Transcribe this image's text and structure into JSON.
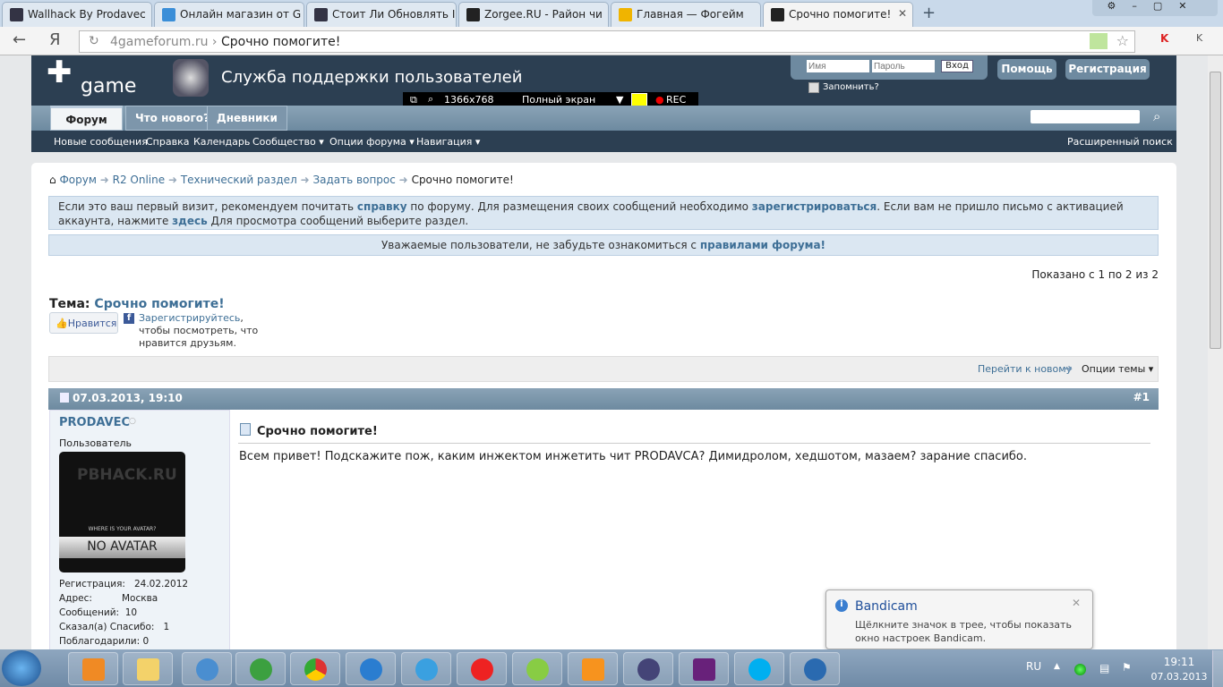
{
  "browser": {
    "tabs": [
      {
        "title": "Wallhack By Prodavec"
      },
      {
        "title": "Онлайн магазин от G"
      },
      {
        "title": "Стоит Ли Обновлять I"
      },
      {
        "title": "Zorgee.RU - Район чи"
      },
      {
        "title": "Главная — Фогейм"
      },
      {
        "title": "Срочно помогите!"
      }
    ],
    "url_domain": "4gameforum.ru",
    "url_sep": "›",
    "url_title": "Срочно помогите!",
    "yandex": "Я"
  },
  "site": {
    "logo": "game",
    "header_title": "Служба поддержки пользователей",
    "login": {
      "user_placeholder": "Имя",
      "pass_placeholder": "Пароль",
      "submit": "Вход",
      "remember": "Запомнить?"
    },
    "help": "Помощь",
    "register": "Регистрация",
    "tabs": [
      "Форум",
      "Что нового?",
      "Дневники"
    ],
    "subnav": [
      "Новые сообщения",
      "Справка",
      "Календарь",
      "Сообщество ▾",
      "Опции форума ▾",
      "Навигация ▾"
    ],
    "advanced_search": "Расширенный поиск"
  },
  "bandicam_bar": {
    "resolution": "1366x768",
    "mode": "Полный экран",
    "rec": "REC"
  },
  "breadcrumb": [
    "Форум",
    "R2 Online",
    "Технический раздел",
    "Задать вопрос",
    "Срочно помогите!"
  ],
  "notice": {
    "t1": "Если это ваш первый визит, рекомендуем почитать ",
    "l1": "справку",
    "t2": " по форуму. Для размещения своих сообщений необходимо ",
    "l2": "зарегистрироваться",
    "t3": ". Если вам не пришло письмо с активацией аккаунта, нажмите ",
    "l3": "здесь",
    "t4": " Для просмотра сообщений выберите раздел."
  },
  "rules": {
    "text": "Уважаемые пользователи, не забудьте ознакомиться с ",
    "link": "правилами форума!"
  },
  "shown": "Показано с 1 по 2 из 2",
  "thread": {
    "label": "Тема:",
    "title": "Срочно помогите!",
    "like": "Нравится",
    "fb_link": "Зарегистрируйтесь",
    "fb_text": ", чтобы посмотреть, что нравится друзьям.",
    "goto_new": "Перейти к новому",
    "options": "Опции темы ▾"
  },
  "post": {
    "date": "07.03.2013, 19:10",
    "num": "#1",
    "user": "PRODAVEC",
    "role": "Пользователь",
    "avatar_top": "PBHACK.RU",
    "avatar_sub": "WHERE IS YOUR AVATAR?",
    "avatar_main": "NO AVATAR",
    "stats": [
      {
        "k": "Регистрация:",
        "v": "24.02.2012"
      },
      {
        "k": "Адрес:",
        "v": "Москва"
      },
      {
        "k": "Сообщений:",
        "v": "10"
      },
      {
        "k": "Сказал(а) Спасибо:",
        "v": "1"
      },
      {
        "k": "Поблагодарили:",
        "v": "0"
      }
    ],
    "title": "Срочно помогите!",
    "body": "Всем привет! Подскажите пож, каким инжектом инжетить чит PRODAVCA? Димидролом, хедшотом, мазаем? зарание спасибо."
  },
  "bandicam": {
    "title": "Bandicam",
    "text": "Щёлкните значок в трее, чтобы показать окно настроек Bandicam."
  },
  "tray": {
    "lang": "RU",
    "time": "19:11",
    "date": "07.03.2013"
  }
}
